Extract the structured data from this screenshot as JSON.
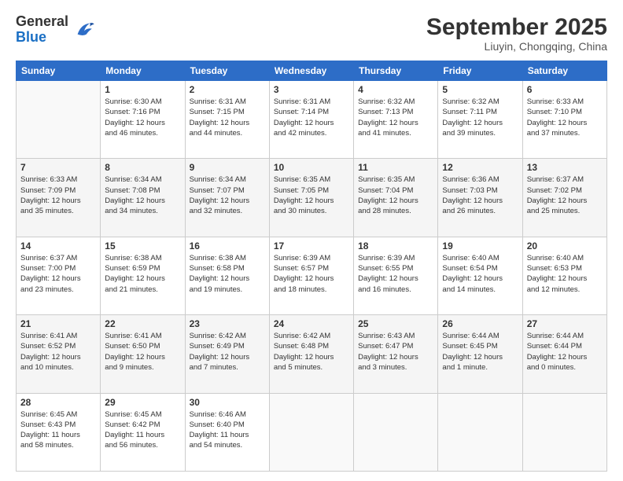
{
  "header": {
    "logo_general": "General",
    "logo_blue": "Blue",
    "main_title": "September 2025",
    "subtitle": "Liuyin, Chongqing, China"
  },
  "columns": [
    "Sunday",
    "Monday",
    "Tuesday",
    "Wednesday",
    "Thursday",
    "Friday",
    "Saturday"
  ],
  "weeks": [
    [
      {
        "day": "",
        "content": ""
      },
      {
        "day": "1",
        "content": "Sunrise: 6:30 AM\nSunset: 7:16 PM\nDaylight: 12 hours\nand 46 minutes."
      },
      {
        "day": "2",
        "content": "Sunrise: 6:31 AM\nSunset: 7:15 PM\nDaylight: 12 hours\nand 44 minutes."
      },
      {
        "day": "3",
        "content": "Sunrise: 6:31 AM\nSunset: 7:14 PM\nDaylight: 12 hours\nand 42 minutes."
      },
      {
        "day": "4",
        "content": "Sunrise: 6:32 AM\nSunset: 7:13 PM\nDaylight: 12 hours\nand 41 minutes."
      },
      {
        "day": "5",
        "content": "Sunrise: 6:32 AM\nSunset: 7:11 PM\nDaylight: 12 hours\nand 39 minutes."
      },
      {
        "day": "6",
        "content": "Sunrise: 6:33 AM\nSunset: 7:10 PM\nDaylight: 12 hours\nand 37 minutes."
      }
    ],
    [
      {
        "day": "7",
        "content": "Sunrise: 6:33 AM\nSunset: 7:09 PM\nDaylight: 12 hours\nand 35 minutes."
      },
      {
        "day": "8",
        "content": "Sunrise: 6:34 AM\nSunset: 7:08 PM\nDaylight: 12 hours\nand 34 minutes."
      },
      {
        "day": "9",
        "content": "Sunrise: 6:34 AM\nSunset: 7:07 PM\nDaylight: 12 hours\nand 32 minutes."
      },
      {
        "day": "10",
        "content": "Sunrise: 6:35 AM\nSunset: 7:05 PM\nDaylight: 12 hours\nand 30 minutes."
      },
      {
        "day": "11",
        "content": "Sunrise: 6:35 AM\nSunset: 7:04 PM\nDaylight: 12 hours\nand 28 minutes."
      },
      {
        "day": "12",
        "content": "Sunrise: 6:36 AM\nSunset: 7:03 PM\nDaylight: 12 hours\nand 26 minutes."
      },
      {
        "day": "13",
        "content": "Sunrise: 6:37 AM\nSunset: 7:02 PM\nDaylight: 12 hours\nand 25 minutes."
      }
    ],
    [
      {
        "day": "14",
        "content": "Sunrise: 6:37 AM\nSunset: 7:00 PM\nDaylight: 12 hours\nand 23 minutes."
      },
      {
        "day": "15",
        "content": "Sunrise: 6:38 AM\nSunset: 6:59 PM\nDaylight: 12 hours\nand 21 minutes."
      },
      {
        "day": "16",
        "content": "Sunrise: 6:38 AM\nSunset: 6:58 PM\nDaylight: 12 hours\nand 19 minutes."
      },
      {
        "day": "17",
        "content": "Sunrise: 6:39 AM\nSunset: 6:57 PM\nDaylight: 12 hours\nand 18 minutes."
      },
      {
        "day": "18",
        "content": "Sunrise: 6:39 AM\nSunset: 6:55 PM\nDaylight: 12 hours\nand 16 minutes."
      },
      {
        "day": "19",
        "content": "Sunrise: 6:40 AM\nSunset: 6:54 PM\nDaylight: 12 hours\nand 14 minutes."
      },
      {
        "day": "20",
        "content": "Sunrise: 6:40 AM\nSunset: 6:53 PM\nDaylight: 12 hours\nand 12 minutes."
      }
    ],
    [
      {
        "day": "21",
        "content": "Sunrise: 6:41 AM\nSunset: 6:52 PM\nDaylight: 12 hours\nand 10 minutes."
      },
      {
        "day": "22",
        "content": "Sunrise: 6:41 AM\nSunset: 6:50 PM\nDaylight: 12 hours\nand 9 minutes."
      },
      {
        "day": "23",
        "content": "Sunrise: 6:42 AM\nSunset: 6:49 PM\nDaylight: 12 hours\nand 7 minutes."
      },
      {
        "day": "24",
        "content": "Sunrise: 6:42 AM\nSunset: 6:48 PM\nDaylight: 12 hours\nand 5 minutes."
      },
      {
        "day": "25",
        "content": "Sunrise: 6:43 AM\nSunset: 6:47 PM\nDaylight: 12 hours\nand 3 minutes."
      },
      {
        "day": "26",
        "content": "Sunrise: 6:44 AM\nSunset: 6:45 PM\nDaylight: 12 hours\nand 1 minute."
      },
      {
        "day": "27",
        "content": "Sunrise: 6:44 AM\nSunset: 6:44 PM\nDaylight: 12 hours\nand 0 minutes."
      }
    ],
    [
      {
        "day": "28",
        "content": "Sunrise: 6:45 AM\nSunset: 6:43 PM\nDaylight: 11 hours\nand 58 minutes."
      },
      {
        "day": "29",
        "content": "Sunrise: 6:45 AM\nSunset: 6:42 PM\nDaylight: 11 hours\nand 56 minutes."
      },
      {
        "day": "30",
        "content": "Sunrise: 6:46 AM\nSunset: 6:40 PM\nDaylight: 11 hours\nand 54 minutes."
      },
      {
        "day": "",
        "content": ""
      },
      {
        "day": "",
        "content": ""
      },
      {
        "day": "",
        "content": ""
      },
      {
        "day": "",
        "content": ""
      }
    ]
  ]
}
